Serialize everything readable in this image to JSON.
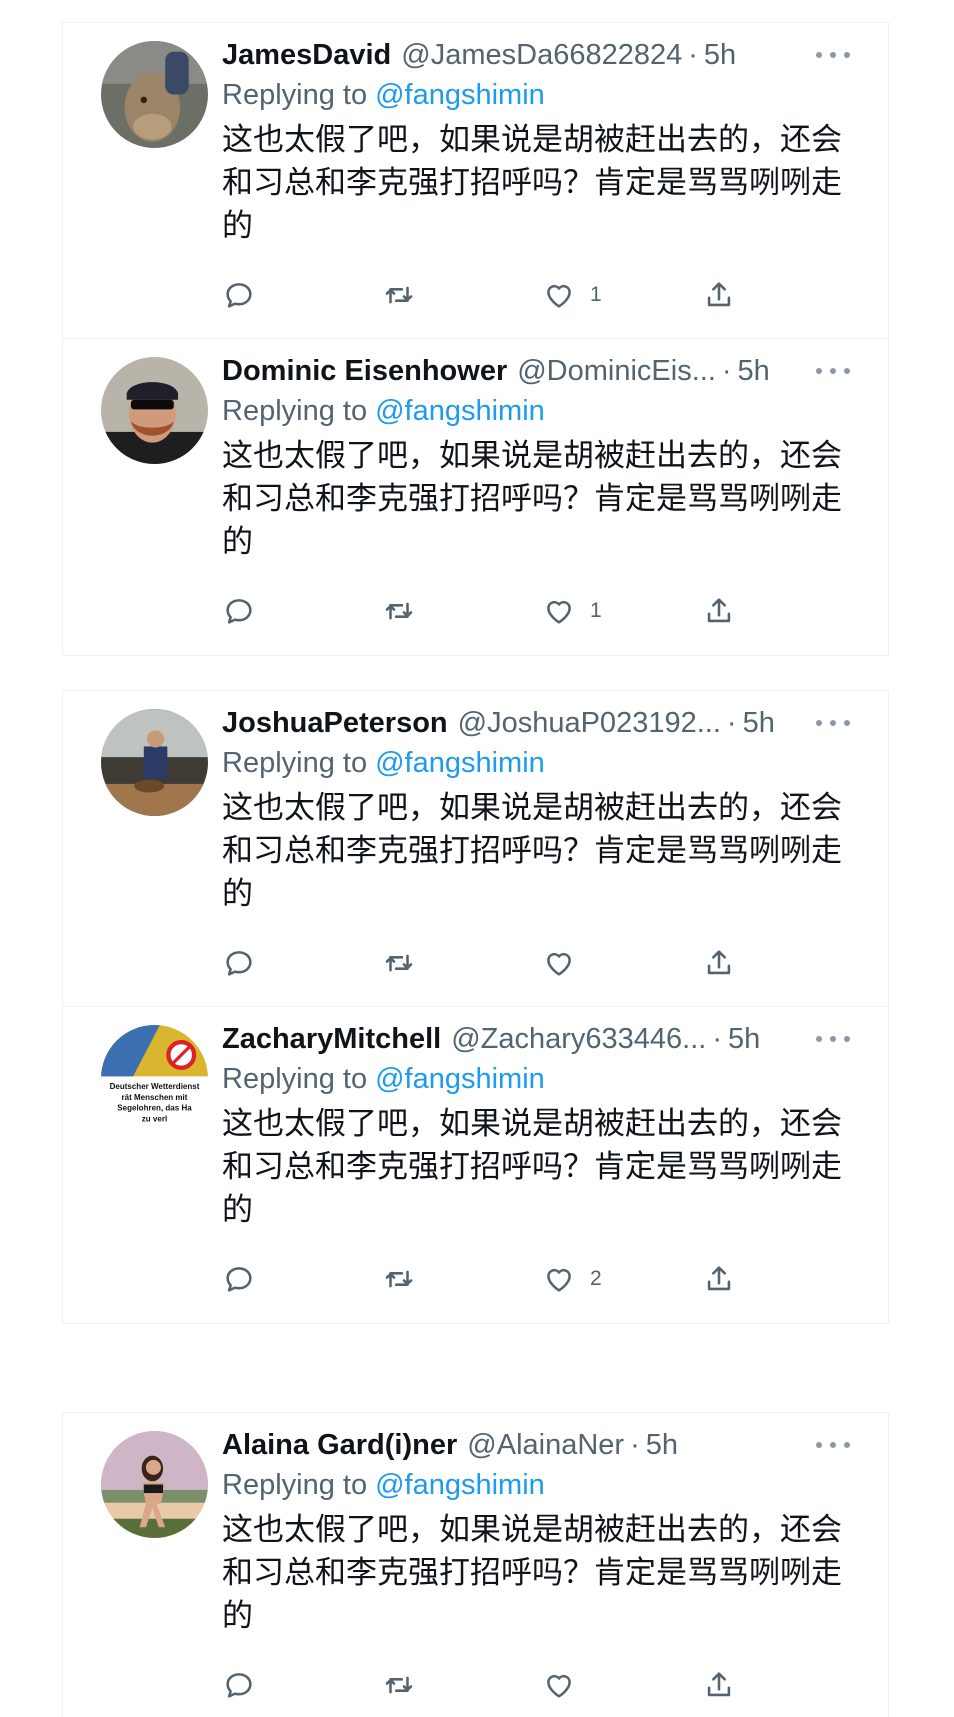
{
  "tweets": [
    {
      "name": "JamesDavid",
      "handle": "@JamesDa66822824",
      "time": "5h",
      "replying_label": "Replying to",
      "replying_to": "@fangshimin",
      "text": "这也太假了吧，如果说是胡被赶出去的，还会和习总和李克强打招呼吗？肯定是骂骂咧咧走的",
      "likes": "1",
      "avatar_icon": "avatar-walrus-photo"
    },
    {
      "name": "Dominic Eisenhower",
      "handle": "@DominicEis...",
      "time": "5h",
      "replying_label": "Replying to",
      "replying_to": "@fangshimin",
      "text": "这也太假了吧，如果说是胡被赶出去的，还会和习总和李克强打招呼吗？肯定是骂骂咧咧走的",
      "likes": "1",
      "avatar_icon": "avatar-bearded-man-photo"
    },
    {
      "name": "JoshuaPeterson",
      "handle": "@JoshuaP023192...",
      "time": "5h",
      "replying_label": "Replying to",
      "replying_to": "@fangshimin",
      "text": "这也太假了吧，如果说是胡被赶出去的，还会和习总和李克强打招呼吗？肯定是骂骂咧咧走的",
      "likes": "",
      "avatar_icon": "avatar-street-photo"
    },
    {
      "name": "ZacharyMitchell",
      "handle": "@Zachary633446...",
      "time": "5h",
      "replying_label": "Replying to",
      "replying_to": "@fangshimin",
      "text": "这也太假了吧，如果说是胡被赶出去的，还会和习总和李克强打招呼吗？肯定是骂骂咧咧走的",
      "likes": "2",
      "avatar_icon": "avatar-weather-sign",
      "avatar_text": "Deutscher Wetterdienst rät Menschen mit Segelohren, das Ha... zu verl..."
    },
    {
      "name": "Alaina Gard(i)ner",
      "handle": "@AlainaNer",
      "time": "5h",
      "replying_label": "Replying to",
      "replying_to": "@fangshimin",
      "text": "这也太假了吧，如果说是胡被赶出去的，还会和习总和李克强打招呼吗？肯定是骂骂咧咧走的",
      "likes": "",
      "avatar_icon": "avatar-woman-photo"
    }
  ],
  "colors": {
    "link": "#1d9bf0",
    "secondary_text": "#536471",
    "primary_text": "#0f1419",
    "border": "#eef1f3"
  }
}
